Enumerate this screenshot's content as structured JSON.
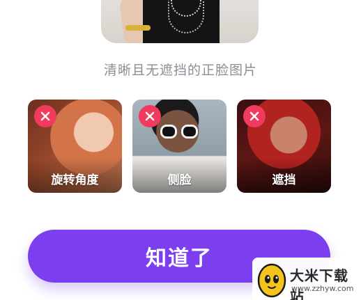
{
  "hint": {
    "text": "清晰且无遮挡的正脸图片"
  },
  "examples": [
    {
      "label": "旋转角度",
      "icon": "close-icon"
    },
    {
      "label": "侧脸",
      "icon": "close-icon"
    },
    {
      "label": "遮挡",
      "icon": "close-icon"
    }
  ],
  "confirm_button": {
    "label": "知道了"
  },
  "watermark": {
    "title": "大米下载站",
    "url": "www.zzhyw.com"
  },
  "colors": {
    "accent": "#7c3ff0",
    "close_badge": "#f23a5e",
    "hint_text": "#8d8d96"
  }
}
